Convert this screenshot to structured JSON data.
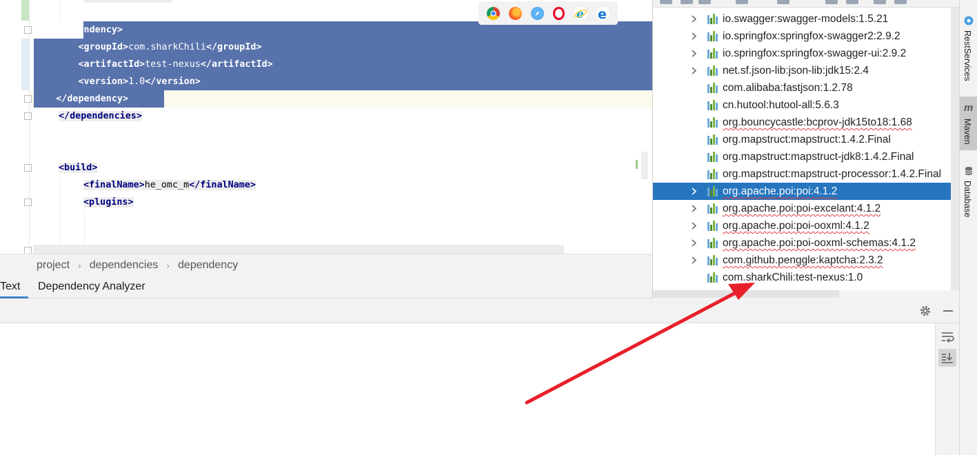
{
  "editor": {
    "lines": [
      {
        "indent": "    ",
        "open": "<dependency>",
        "selected": true
      },
      {
        "indent": "        ",
        "open": "<groupId>",
        "text": "com.sharkChili",
        "close": "</groupId>",
        "selected": true
      },
      {
        "indent": "        ",
        "open": "<artifactId>",
        "text": "test-nexus",
        "close": "</artifactId>",
        "selected": true
      },
      {
        "indent": "        ",
        "open": "<version>",
        "text": "1.0",
        "close": "</version>",
        "selected": true
      },
      {
        "indent": "    ",
        "close": "</dependency>",
        "selected": true
      },
      {
        "indent": "",
        "close": "</dependencies>"
      },
      {
        "indent": "",
        "open": "<build>"
      },
      {
        "indent": "    ",
        "open": "<finalName>",
        "text": "he_omc_m",
        "close": "</finalName>"
      },
      {
        "indent": "    ",
        "open": "<plugins>"
      }
    ],
    "browser_icons": [
      "chrome-icon",
      "firefox-icon",
      "safari-icon",
      "opera-icon",
      "internet-explorer-icon",
      "edge-icon"
    ]
  },
  "breadcrumb": [
    "project",
    "dependencies",
    "dependency"
  ],
  "tabs": {
    "active": "Text",
    "second": "Dependency Analyzer"
  },
  "maven": {
    "items": [
      {
        "label": "io.swagger:swagger-models:1.5.21",
        "expandable": true,
        "squiggle": false
      },
      {
        "label": "io.springfox:springfox-swagger2:2.9.2",
        "expandable": true,
        "squiggle": false
      },
      {
        "label": "io.springfox:springfox-swagger-ui:2.9.2",
        "expandable": true,
        "squiggle": false
      },
      {
        "label": "net.sf.json-lib:json-lib:jdk15:2.4",
        "expandable": true,
        "squiggle": false
      },
      {
        "label": "com.alibaba:fastjson:1.2.78",
        "expandable": false,
        "squiggle": false
      },
      {
        "label": "cn.hutool:hutool-all:5.6.3",
        "expandable": false,
        "squiggle": false
      },
      {
        "label": "org.bouncycastle:bcprov-jdk15to18:1.68",
        "expandable": false,
        "squiggle": true
      },
      {
        "label": "org.mapstruct:mapstruct:1.4.2.Final",
        "expandable": false,
        "squiggle": false
      },
      {
        "label": "org.mapstruct:mapstruct-jdk8:1.4.2.Final",
        "expandable": false,
        "squiggle": false
      },
      {
        "label": "org.mapstruct:mapstruct-processor:1.4.2.Final",
        "expandable": false,
        "squiggle": false
      },
      {
        "label": "org.apache.poi:poi:4.1.2",
        "expandable": true,
        "squiggle": true,
        "selected": true
      },
      {
        "label": "org.apache.poi:poi-excelant:4.1.2",
        "expandable": true,
        "squiggle": true
      },
      {
        "label": "org.apache.poi:poi-ooxml:4.1.2",
        "expandable": true,
        "squiggle": true
      },
      {
        "label": "org.apache.poi:poi-ooxml-schemas:4.1.2",
        "expandable": true,
        "squiggle": true
      },
      {
        "label": "com.github.penggle:kaptcha:2.3.2",
        "expandable": true,
        "squiggle": true
      },
      {
        "label": "com.sharkChili:test-nexus:1.0",
        "expandable": false,
        "squiggle": false
      }
    ]
  },
  "stripe": {
    "rest_services": "RestServices",
    "maven": "Maven",
    "database": "Database"
  },
  "colors": {
    "selection": "#5872ab",
    "tree_selection": "#2675bf",
    "tag": "#000080",
    "arrow": "#e8202a"
  }
}
